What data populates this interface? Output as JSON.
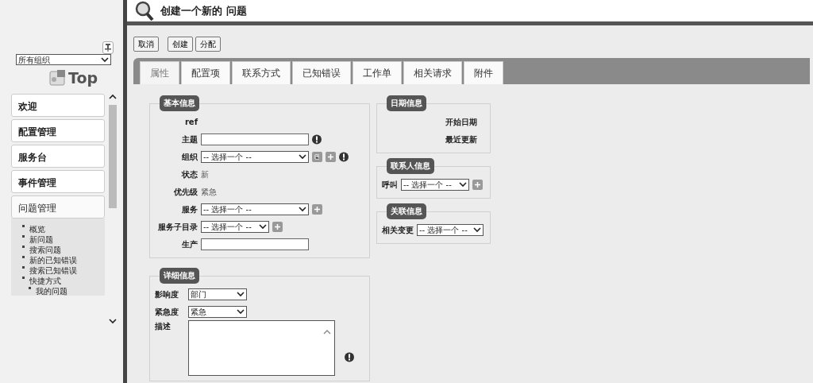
{
  "sidebar": {
    "org_select": {
      "value": "所有组织"
    },
    "logo": {
      "text": "Top"
    },
    "menu": [
      {
        "label": "欢迎",
        "expanded": false
      },
      {
        "label": "配置管理",
        "expanded": false
      },
      {
        "label": "服务台",
        "expanded": false
      },
      {
        "label": "事件管理",
        "expanded": false
      },
      {
        "label": "问题管理",
        "expanded": true,
        "children": [
          {
            "label": "概览"
          },
          {
            "label": "新问题"
          },
          {
            "label": "搜索问题"
          },
          {
            "label": "新的已知错误"
          },
          {
            "label": "搜索已知错误"
          },
          {
            "label": "快捷方式",
            "children": [
              {
                "label": "我的问题"
              }
            ]
          }
        ]
      }
    ]
  },
  "page": {
    "title": "创建一个新的 问题"
  },
  "buttons": [
    "取消",
    "创建",
    "分配"
  ],
  "tabs": [
    {
      "label": "属性",
      "selected": true
    },
    {
      "label": "配置项",
      "selected": false
    },
    {
      "label": "联系方式",
      "selected": false
    },
    {
      "label": "已知错误",
      "selected": false
    },
    {
      "label": "工作单",
      "selected": false
    },
    {
      "label": "相关请求",
      "selected": false
    },
    {
      "label": "附件",
      "selected": false
    }
  ],
  "left_column": [
    {
      "legend": "基本信息",
      "fields": [
        {
          "label": "ref",
          "kind": "text"
        },
        {
          "label": "主题",
          "kind": "input",
          "required": true
        },
        {
          "label": "组织",
          "kind": "select",
          "value": "-- 选择一个 --",
          "tree_button": true,
          "add_button": true,
          "required": true
        },
        {
          "label": "状态",
          "kind": "text",
          "value": "新"
        },
        {
          "label": "优先级",
          "kind": "text",
          "value": "紧急"
        },
        {
          "label": "服务",
          "kind": "select",
          "value": "-- 选择一个 --",
          "add_button": true
        },
        {
          "label": "服务子目录",
          "kind": "short_select",
          "value": "-- 选择一个 --",
          "add_button": true
        },
        {
          "label": "生产",
          "kind": "input"
        }
      ]
    },
    {
      "legend": "详细信息",
      "fields": [
        {
          "label": "影响度",
          "kind": "medium_select",
          "value": "部门"
        },
        {
          "label": "紧急度",
          "kind": "medium_select",
          "value": "紧急"
        },
        {
          "label": "描述",
          "kind": "textarea",
          "required": true
        }
      ]
    }
  ],
  "right_column": [
    {
      "legend": "日期信息",
      "fields": [
        {
          "label": "开始日期",
          "kind": "text"
        },
        {
          "label": "最近更新",
          "kind": "text"
        }
      ]
    },
    {
      "legend": "联系人信息",
      "fields": [
        {
          "label": "呼叫",
          "kind": "short_select",
          "value": "-- 选择一个 --",
          "add_button": true
        }
      ]
    },
    {
      "legend": "关联信息",
      "fields": [
        {
          "label": "相关变更",
          "kind": "short_select",
          "value": "-- 选择一个 --"
        }
      ]
    }
  ]
}
